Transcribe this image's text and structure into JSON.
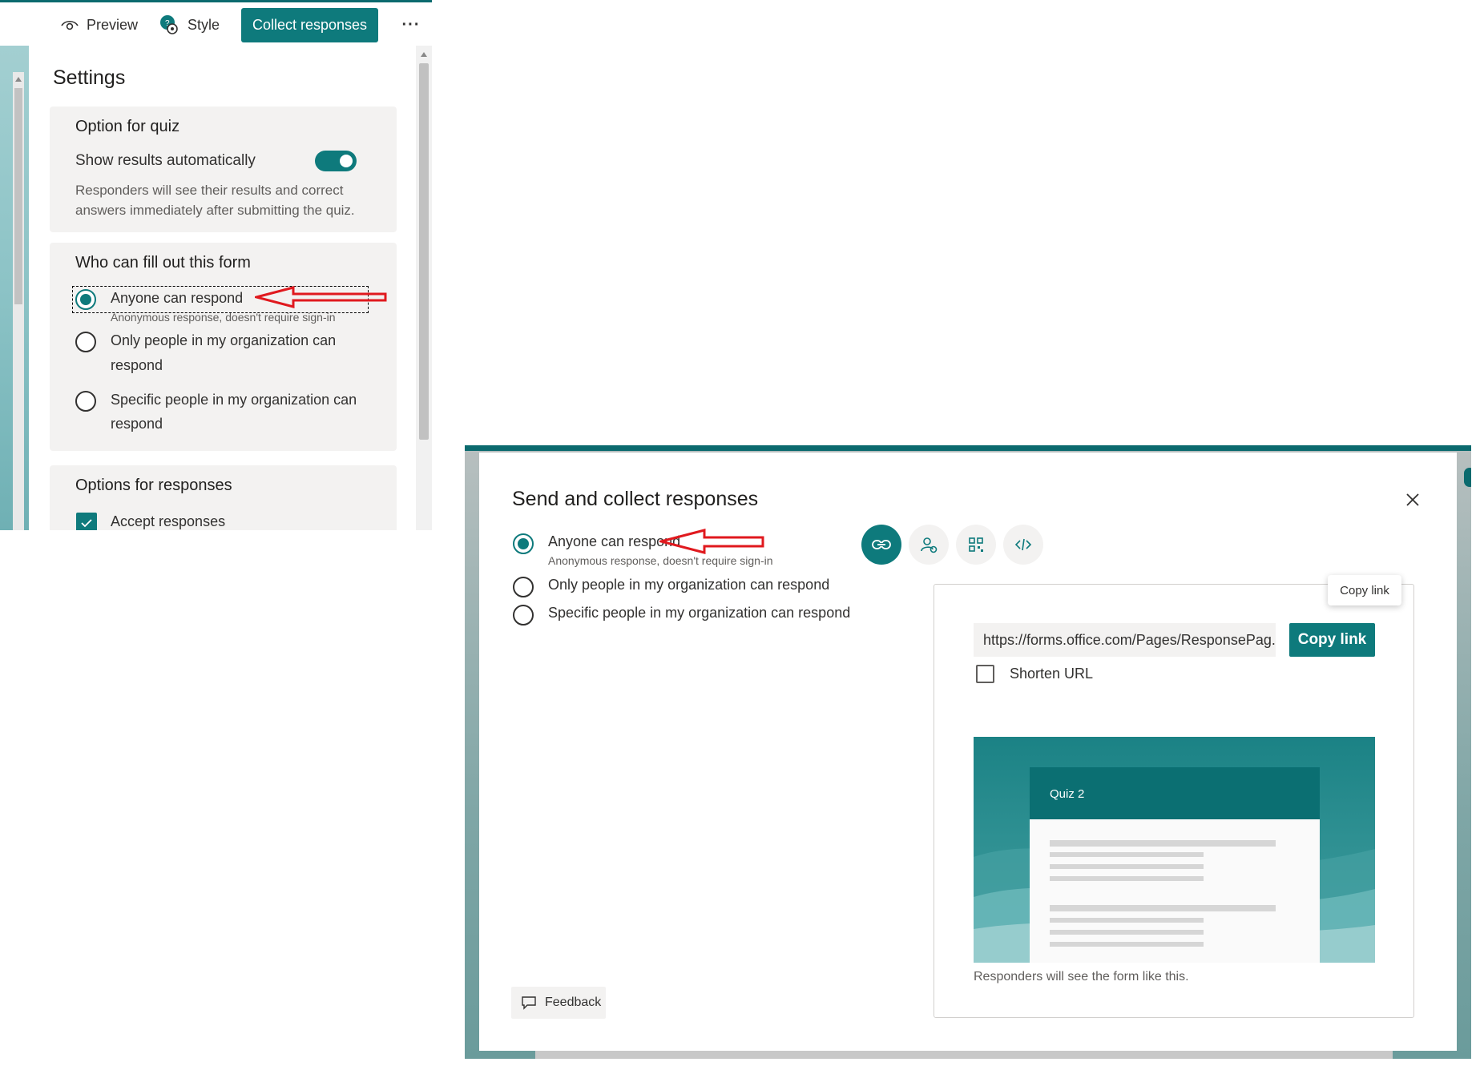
{
  "toolbar": {
    "preview_label": "Preview",
    "style_label": "Style",
    "collect_label": "Collect responses",
    "more_label": "···"
  },
  "settings": {
    "title": "Settings",
    "quiz_section": {
      "title": "Option for quiz",
      "toggle_label": "Show results automatically",
      "toggle_on": true,
      "description_line1": "Responders will see their results and correct",
      "description_line2": "answers immediately after submitting the quiz."
    },
    "who_section": {
      "title": "Who can fill out this form",
      "options": [
        {
          "label": "Anyone can respond",
          "sub": "Anonymous response, doesn't require sign-in",
          "selected": true
        },
        {
          "label_line1": "Only people in my organization can",
          "label_line2": "respond",
          "selected": false
        },
        {
          "label_line1": "Specific people in my organization can",
          "label_line2": "respond",
          "selected": false
        }
      ]
    },
    "options_section": {
      "title": "Options for responses",
      "accept_label": "Accept responses",
      "accept_checked": true
    }
  },
  "dialog": {
    "title": "Send and collect responses",
    "options": [
      {
        "label": "Anyone can respond",
        "sub": "Anonymous response, doesn't require sign-in",
        "selected": true
      },
      {
        "label": "Only people in my organization can respond",
        "selected": false
      },
      {
        "label": "Specific people in my organization can respond",
        "selected": false
      }
    ],
    "share_icons": [
      "link-icon",
      "invite-people-icon",
      "qr-code-icon",
      "embed-code-icon"
    ],
    "tooltip": "Copy link",
    "url": "https://forms.office.com/Pages/ResponsePag...",
    "copy_button": "Copy link",
    "shorten_label": "Shorten URL",
    "shorten_checked": false,
    "preview_form_title": "Quiz 2",
    "preview_caption": "Responders will see the form like this.",
    "feedback_label": "Feedback"
  },
  "colors": {
    "accent": "#0e7a7c",
    "annotation_arrow": "#e0191e"
  }
}
